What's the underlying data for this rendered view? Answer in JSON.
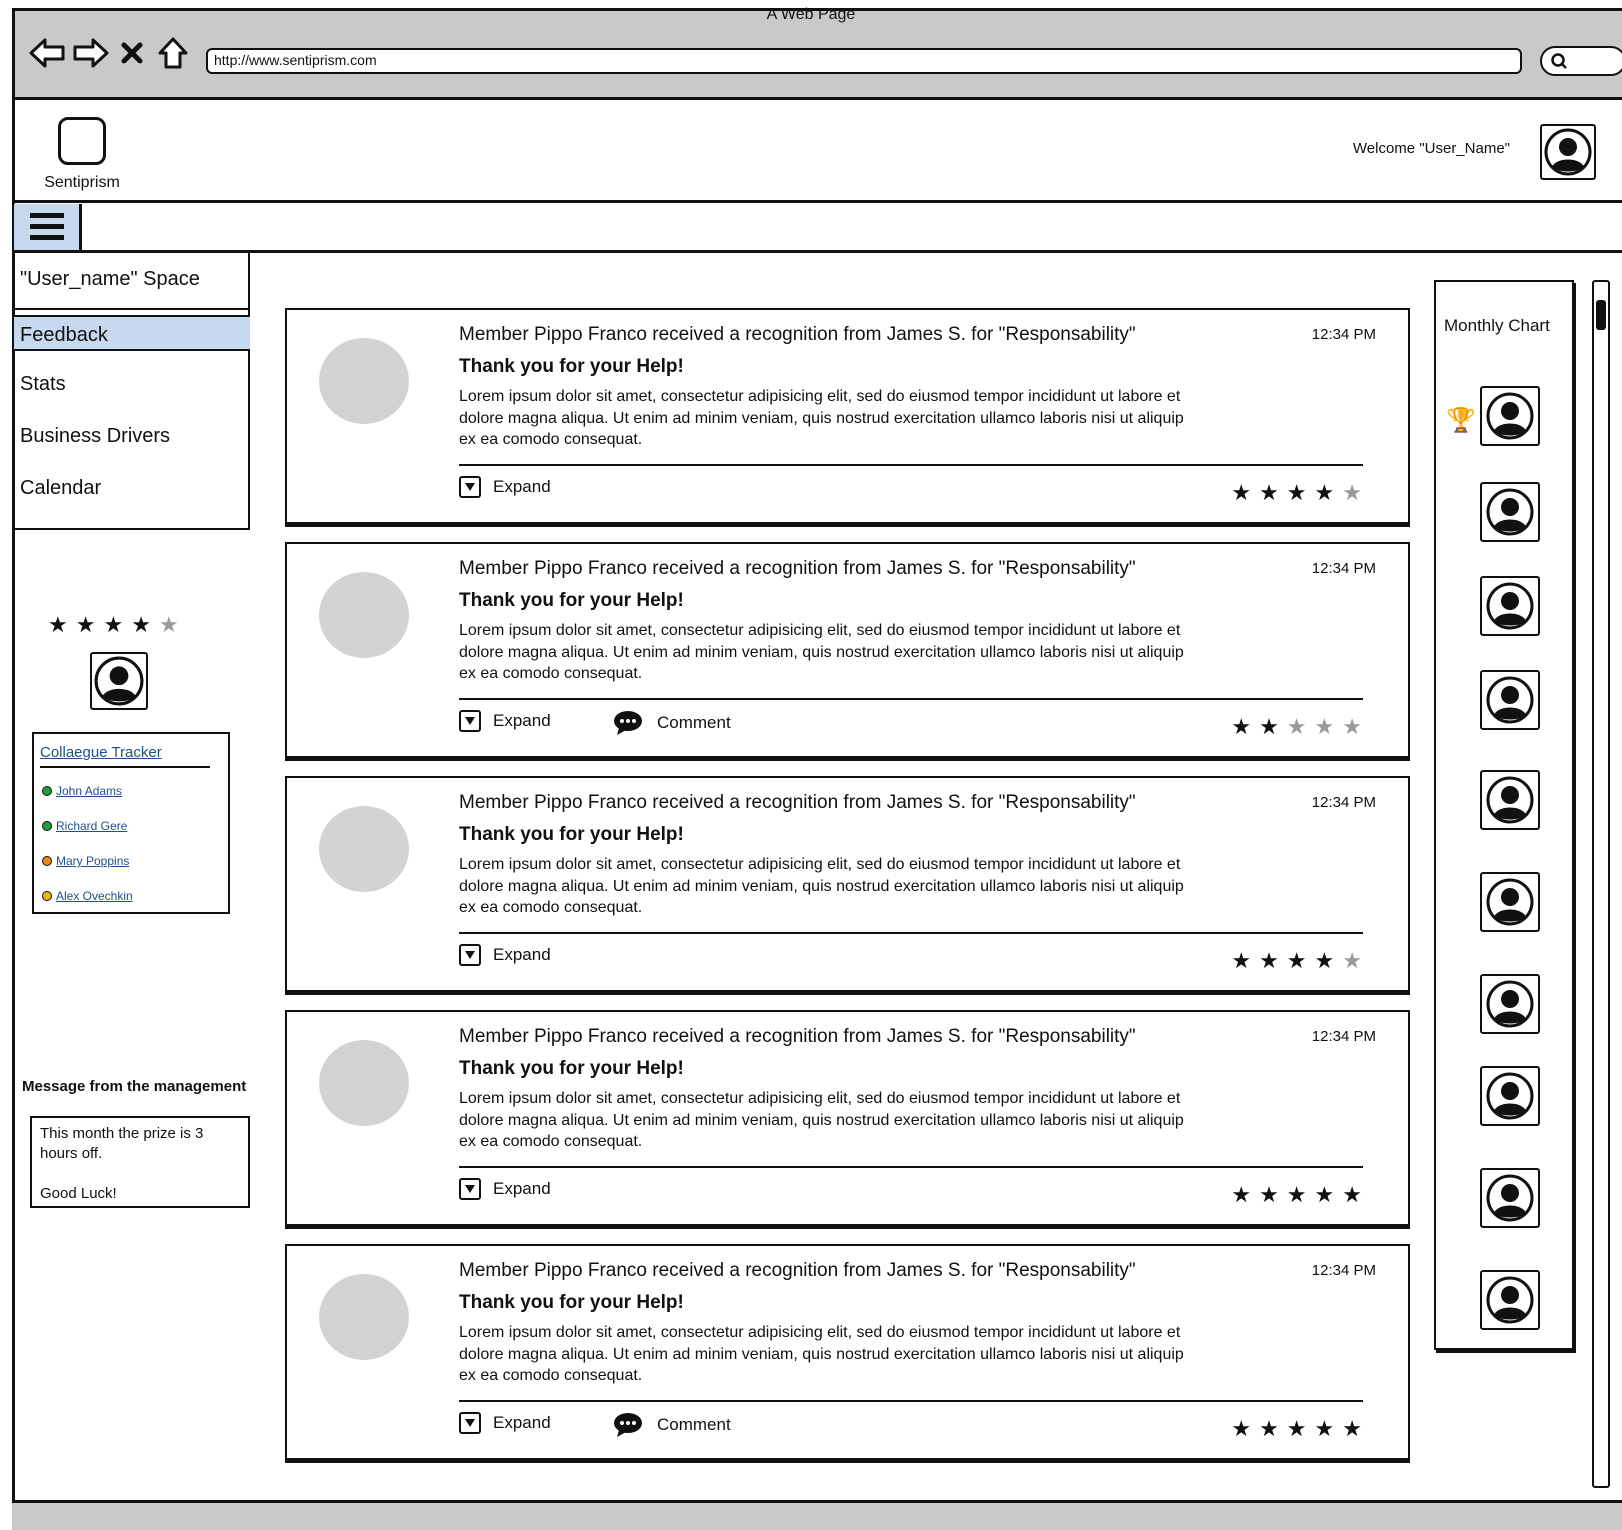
{
  "browser": {
    "title": "A Web Page",
    "url": "http://www.sentiprism.com"
  },
  "header": {
    "logo_text": "Sentiprism",
    "welcome": "Welcome \"User_Name\""
  },
  "nav": {
    "title": "\"User_name\" Space",
    "items": [
      "Feedback",
      "Stats",
      "Business Drivers",
      "Calendar"
    ],
    "selected": "Feedback"
  },
  "left": {
    "rating": 4,
    "rating_max": 5,
    "tracker": {
      "title": "Collaegue Tracker",
      "colleagues": [
        {
          "name": "John Adams",
          "status_color": "#1f9e3a"
        },
        {
          "name": "Richard Gere",
          "status_color": "#1f9e3a"
        },
        {
          "name": "Mary Poppins",
          "status_color": "#e8891a"
        },
        {
          "name": "Alex Ovechkin",
          "status_color": "#e8b81a"
        }
      ]
    },
    "management": {
      "title": "Message from the management",
      "message": "This month the prize is 3 hours off.\n\nGood Luck!"
    }
  },
  "feed": [
    {
      "headline": "Member Pippo Franco received a recognition from James S. for \"Responsability\"",
      "time": "12:34 PM",
      "subtitle": "Thank you for your Help!",
      "body": "Lorem ipsum dolor sit amet, consectetur adipisicing elit, sed do eiusmod tempor incididunt ut labore et dolore magna aliqua. Ut enim ad minim veniam, quis nostrud exercitation ullamco laboris nisi ut aliquip ex ea comodo consequat.",
      "expand": "Expand",
      "comment": "",
      "rating": 4
    },
    {
      "headline": "Member Pippo Franco received a recognition from James S. for \"Responsability\"",
      "time": "12:34 PM",
      "subtitle": "Thank you for your Help!",
      "body": "Lorem ipsum dolor sit amet, consectetur adipisicing elit, sed do eiusmod tempor incididunt ut labore et dolore magna aliqua. Ut enim ad minim veniam, quis nostrud exercitation ullamco laboris nisi ut aliquip ex ea comodo consequat.",
      "expand": "Expand",
      "comment": "Comment",
      "rating": 2
    },
    {
      "headline": "Member Pippo Franco received a recognition from James S. for \"Responsability\"",
      "time": "12:34 PM",
      "subtitle": "Thank you for your Help!",
      "body": "Lorem ipsum dolor sit amet, consectetur adipisicing elit, sed do eiusmod tempor incididunt ut labore et dolore magna aliqua. Ut enim ad minim veniam, quis nostrud exercitation ullamco laboris nisi ut aliquip ex ea comodo consequat.",
      "expand": "Expand",
      "comment": "",
      "rating": 4
    },
    {
      "headline": "Member Pippo Franco received a recognition from James S. for \"Responsability\"",
      "time": "12:34 PM",
      "subtitle": "Thank you for your Help!",
      "body": "Lorem ipsum dolor sit amet, consectetur adipisicing elit, sed do eiusmod tempor incididunt ut labore et dolore magna aliqua. Ut enim ad minim veniam, quis nostrud exercitation ullamco laboris nisi ut aliquip ex ea comodo consequat.",
      "expand": "Expand",
      "comment": "",
      "rating": 5
    },
    {
      "headline": "Member Pippo Franco received a recognition from James S. for \"Responsability\"",
      "time": "12:34 PM",
      "subtitle": "Thank you for your Help!",
      "body": "Lorem ipsum dolor sit amet, consectetur adipisicing elit, sed do eiusmod tempor incididunt ut labore et dolore magna aliqua. Ut enim ad minim veniam, quis nostrud exercitation ullamco laboris nisi ut aliquip ex ea comodo consequat.",
      "expand": "Expand",
      "comment": "Comment",
      "rating": 5
    }
  ],
  "chart": {
    "title": "Monthly Chart",
    "entries": 10,
    "winner_icon": "trophy-icon"
  },
  "icons": [
    "back-arrow-icon",
    "forward-arrow-icon",
    "stop-icon",
    "home-icon",
    "search-icon",
    "hamburger-icon",
    "user-avatar-icon",
    "expand-icon",
    "comment-icon",
    "star-icon",
    "trophy-icon"
  ]
}
